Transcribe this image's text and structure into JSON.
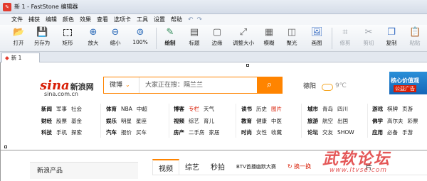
{
  "window": {
    "title": "新 1 - FastStone 编辑器",
    "icon": "faststone-app-icon"
  },
  "menu": [
    "文件",
    "捕获",
    "编辑",
    "颜色",
    "效果",
    "查看",
    "选项卡",
    "工具",
    "设置",
    "帮助"
  ],
  "menu_extra": {
    "undo_icon": "undo-arrow-icon",
    "redo_icon": "redo-arrow-icon"
  },
  "toolbar": [
    {
      "label": "打开",
      "icon": "open-folder-icon",
      "enabled": true
    },
    {
      "label": "另存为",
      "icon": "save-disk-icon",
      "enabled": true
    },
    {
      "label": "矩形",
      "icon": "rect-select-icon",
      "enabled": true
    },
    {
      "label": "放大",
      "icon": "zoom-in-icon",
      "enabled": true
    },
    {
      "label": "缩小",
      "icon": "zoom-out-icon",
      "enabled": true
    },
    {
      "label": "100%",
      "icon": "zoom-100-icon",
      "enabled": true
    },
    {
      "label": "绘制",
      "icon": "draw-pen-icon",
      "enabled": true
    },
    {
      "label": "标题",
      "icon": "caption-icon",
      "enabled": true
    },
    {
      "label": "边缘",
      "icon": "edge-icon",
      "enabled": true
    },
    {
      "label": "调整大小",
      "icon": "resize-icon",
      "enabled": true
    },
    {
      "label": "模糊",
      "icon": "blur-icon",
      "enabled": true
    },
    {
      "label": "聚光",
      "icon": "spotlight-icon",
      "enabled": true
    },
    {
      "label": "画图",
      "icon": "paint-icon",
      "enabled": true
    },
    {
      "label": "修剪",
      "icon": "crop-icon",
      "enabled": false
    },
    {
      "label": "剪切",
      "icon": "cut-icon",
      "enabled": false
    },
    {
      "label": "复制",
      "icon": "copy-icon",
      "enabled": true
    },
    {
      "label": "粘贴",
      "icon": "paste-icon",
      "enabled": false
    }
  ],
  "tab": {
    "label": "新 1"
  },
  "page": {
    "logo": {
      "brand": "sina",
      "brand_cn": "新浪网",
      "domain": "sina.com.cn"
    },
    "search": {
      "category": "微博",
      "placeholder": "大家正在搜：隔兰兰"
    },
    "weather": {
      "city": "德阳",
      "temp": "9℃"
    },
    "banner": {
      "line1": "核心价值观",
      "line2": "公益广告"
    },
    "nav": [
      {
        "rows": [
          [
            "新闻",
            "军事",
            "社会"
          ],
          [
            "财经",
            "股票",
            "基金"
          ],
          [
            "科技",
            "手机",
            "探索"
          ]
        ]
      },
      {
        "rows": [
          [
            "体育",
            "NBA",
            "中超"
          ],
          [
            "娱乐",
            "明星",
            "星座"
          ],
          [
            "汽车",
            "报价",
            "买车"
          ]
        ]
      },
      {
        "rows": [
          [
            "博客",
            "专栏",
            "天气"
          ],
          [
            "视频",
            "综艺",
            "育儿"
          ],
          [
            "房产",
            "二手房",
            "家居"
          ]
        ]
      },
      {
        "rows": [
          [
            "读书",
            "历史",
            "图片"
          ],
          [
            "教育",
            "健康",
            "中医"
          ],
          [
            "时尚",
            "女性",
            "收藏"
          ]
        ]
      },
      {
        "rows": [
          [
            "城市",
            "青岛",
            "四川"
          ],
          [
            "旅游",
            "航空",
            "出国"
          ],
          [
            "论坛",
            "交友",
            "SHOW"
          ]
        ]
      },
      {
        "rows": [
          [
            "游戏",
            "棋牌",
            "页游"
          ],
          [
            "佛学",
            "高尔夫",
            "彩票"
          ],
          [
            "应用",
            "必备",
            "手游"
          ]
        ]
      }
    ],
    "products_label": "新浪产品",
    "content_tabs": [
      "视频",
      "综艺",
      "秒拍",
      "BTV首播幽默大赛",
      "换一换",
      "片"
    ]
  },
  "watermark": {
    "line1": "武软论坛",
    "line2": "www.ltvse.com"
  },
  "colors": {
    "accent": "#ff8400",
    "brand": "#d81e06",
    "link_highlight": "#d81e06"
  }
}
